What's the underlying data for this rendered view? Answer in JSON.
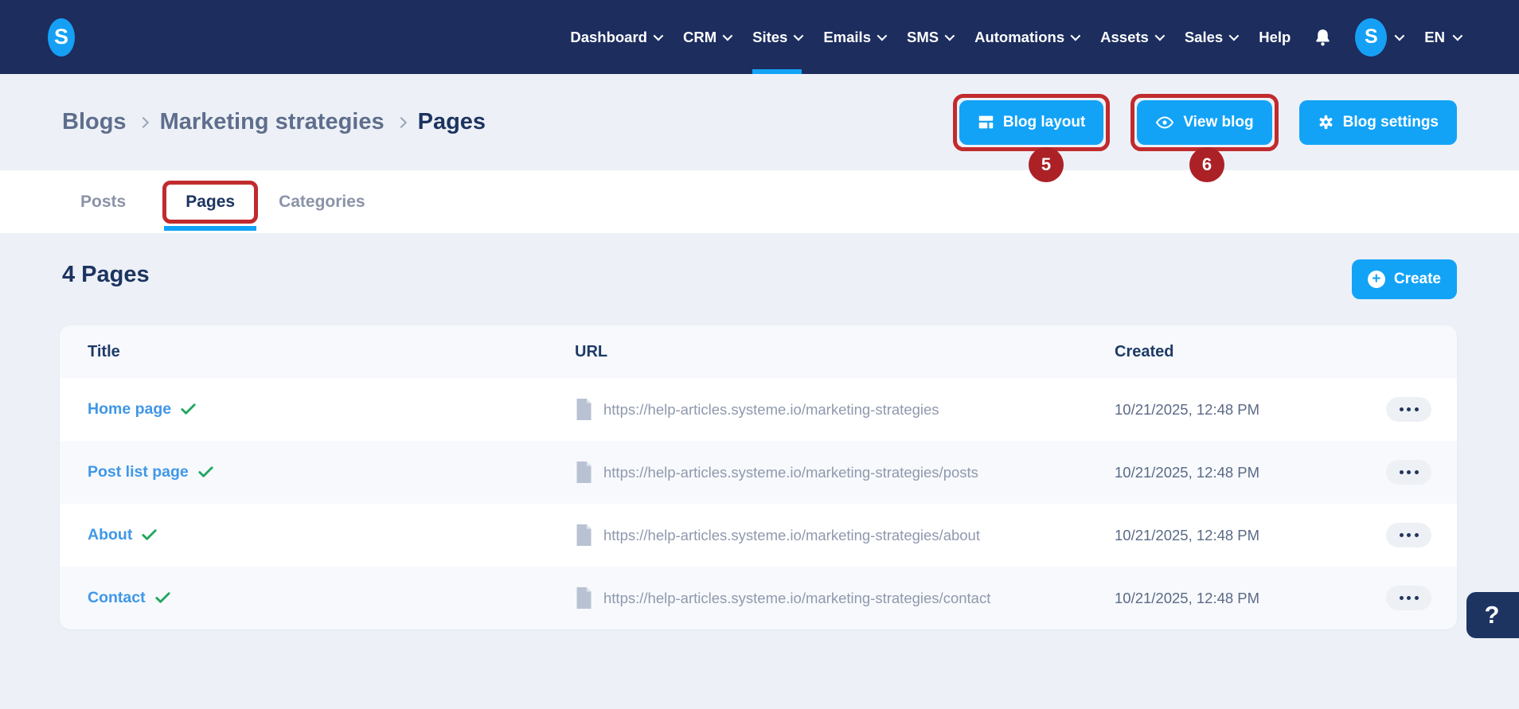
{
  "nav": {
    "logo_letter": "S",
    "items": [
      {
        "label": "Dashboard",
        "has_dropdown": true,
        "active": false
      },
      {
        "label": "CRM",
        "has_dropdown": true,
        "active": false
      },
      {
        "label": "Sites",
        "has_dropdown": true,
        "active": true
      },
      {
        "label": "Emails",
        "has_dropdown": true,
        "active": false
      },
      {
        "label": "SMS",
        "has_dropdown": true,
        "active": false
      },
      {
        "label": "Automations",
        "has_dropdown": true,
        "active": false
      },
      {
        "label": "Assets",
        "has_dropdown": true,
        "active": false
      },
      {
        "label": "Sales",
        "has_dropdown": true,
        "active": false
      },
      {
        "label": "Help",
        "has_dropdown": false,
        "active": false
      }
    ],
    "avatar_letter": "S",
    "language": "EN"
  },
  "breadcrumb": {
    "items": [
      "Blogs",
      "Marketing strategies",
      "Pages"
    ]
  },
  "header_actions": {
    "blog_layout": {
      "label": "Blog layout",
      "badge": "5",
      "annotated": true
    },
    "view_blog": {
      "label": "View blog",
      "badge": "6",
      "annotated": true
    },
    "blog_settings": {
      "label": "Blog settings",
      "annotated": false
    }
  },
  "tabs": [
    {
      "label": "Posts",
      "active": false
    },
    {
      "label": "Pages",
      "active": true,
      "annotated": true
    },
    {
      "label": "Categories",
      "active": false
    }
  ],
  "list": {
    "title": "4 Pages",
    "create_label": "Create",
    "columns": {
      "title": "Title",
      "url": "URL",
      "created": "Created"
    },
    "rows": [
      {
        "title": "Home page",
        "published": true,
        "url": "https://help-articles.systeme.io/marketing-strategies",
        "created": "10/21/2025, 12:48 PM"
      },
      {
        "title": "Post list page",
        "published": true,
        "url": "https://help-articles.systeme.io/marketing-strategies/posts",
        "created": "10/21/2025, 12:48 PM"
      },
      {
        "title": "About",
        "published": true,
        "url": "https://help-articles.systeme.io/marketing-strategies/about",
        "created": "10/21/2025, 12:48 PM"
      },
      {
        "title": "Contact",
        "published": true,
        "url": "https://help-articles.systeme.io/marketing-strategies/contact",
        "created": "10/21/2025, 12:48 PM"
      }
    ]
  },
  "help_button": {
    "label": "?"
  },
  "colors": {
    "nav_navy": "#1c2d5e",
    "accent_blue": "#12a3f7",
    "annotation_red": "#c12b2e",
    "badge_red": "#ab2126",
    "link_blue": "#3f97e8",
    "check_green": "#21a65f",
    "page_bg": "#edf1f7",
    "row_alt_bg": "#f7f9fc",
    "heading_navy": "#1d3461"
  }
}
